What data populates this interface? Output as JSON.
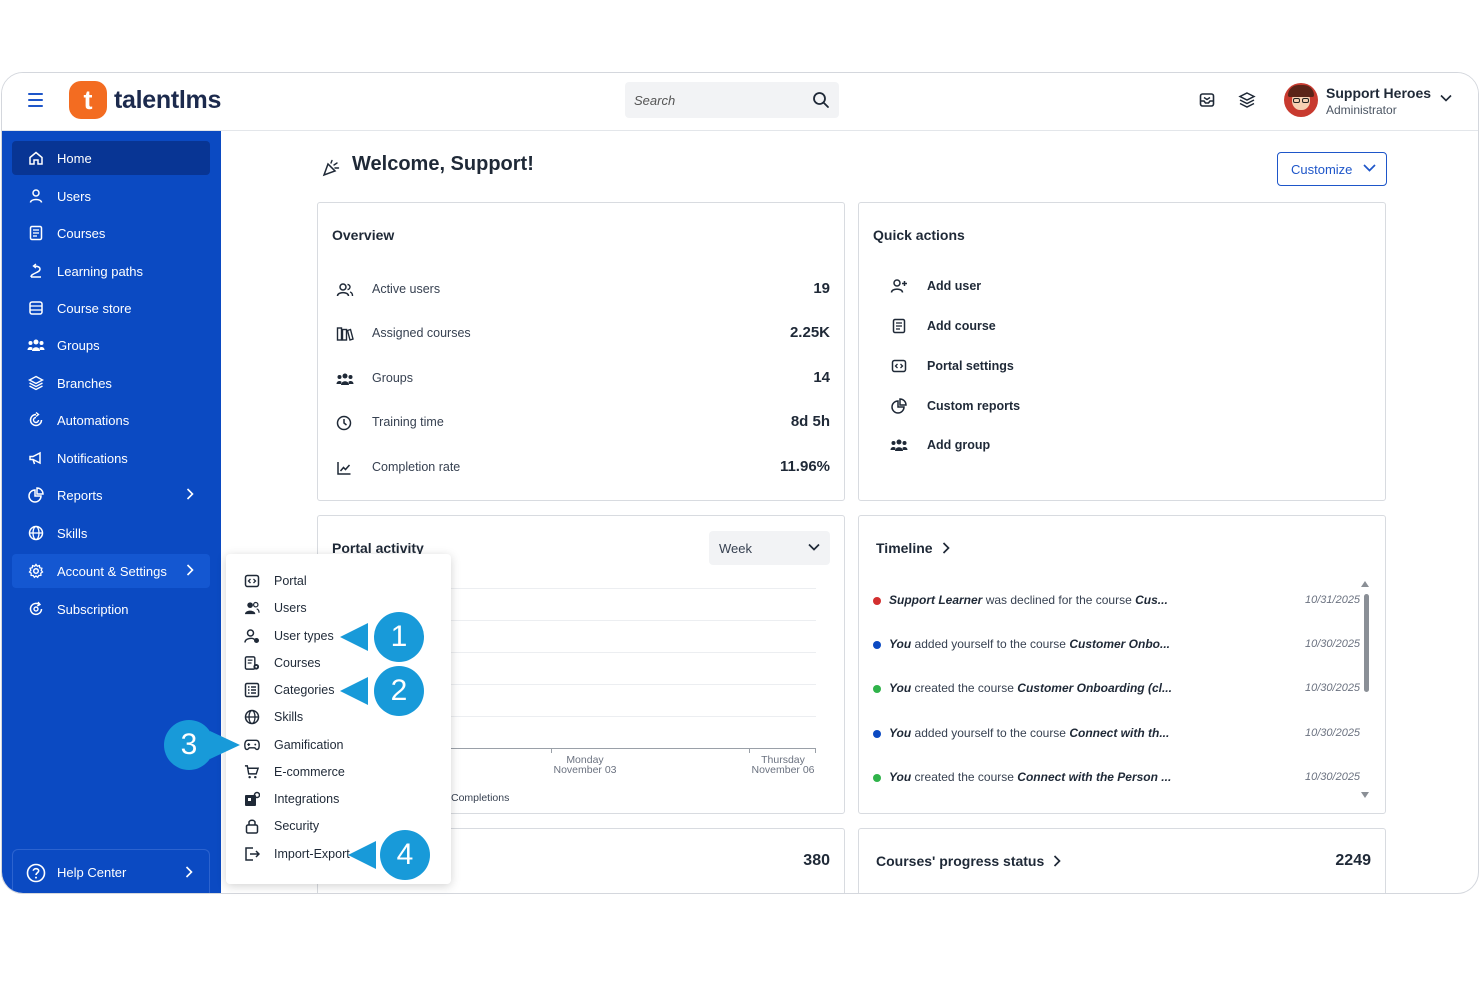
{
  "app": {
    "logo_letter": "t",
    "logo_text": "talentlms",
    "search_placeholder": "Search",
    "user_name": "Support Heroes",
    "user_role": "Administrator"
  },
  "colors": {
    "sidebar": "#0b4ac2",
    "sidebar_active": "#083594",
    "brand_orange": "#f36c21",
    "accent_blue": "#1e56c9",
    "callout": "#189ad9"
  },
  "sidebar": {
    "items": [
      {
        "label": "Home",
        "icon": "home-icon"
      },
      {
        "label": "Users",
        "icon": "user-icon"
      },
      {
        "label": "Courses",
        "icon": "course-icon"
      },
      {
        "label": "Learning paths",
        "icon": "path-icon"
      },
      {
        "label": "Course store",
        "icon": "store-icon"
      },
      {
        "label": "Groups",
        "icon": "groups-icon"
      },
      {
        "label": "Branches",
        "icon": "layers-icon"
      },
      {
        "label": "Automations",
        "icon": "automation-icon"
      },
      {
        "label": "Notifications",
        "icon": "megaphone-icon"
      },
      {
        "label": "Reports",
        "icon": "pie-chart-icon"
      },
      {
        "label": "Skills",
        "icon": "globe-icon"
      },
      {
        "label": "Account & Settings",
        "icon": "gear-icon"
      },
      {
        "label": "Subscription",
        "icon": "subscription-icon"
      }
    ],
    "help": "Help Center"
  },
  "main": {
    "welcome": "Welcome, Support!",
    "customize": "Customize"
  },
  "overview": {
    "title": "Overview",
    "rows": [
      {
        "label": "Active users",
        "value": "19"
      },
      {
        "label": "Assigned courses",
        "value": "2.25K"
      },
      {
        "label": "Groups",
        "value": "14"
      },
      {
        "label": "Training time",
        "value": "8d 5h"
      },
      {
        "label": "Completion rate",
        "value": "11.96%"
      }
    ]
  },
  "quick_actions": {
    "title": "Quick actions",
    "items": [
      "Add user",
      "Add course",
      "Portal settings",
      "Custom reports",
      "Add group"
    ]
  },
  "portal_activity": {
    "title": "Portal activity",
    "period": "Week",
    "x_labels": [
      {
        "day": "Monday",
        "date": "November 03"
      },
      {
        "day": "Thursday",
        "date": "November 06"
      }
    ],
    "legend": "Completions"
  },
  "timeline": {
    "title": "Timeline",
    "rows": [
      {
        "actor": "Support Learner",
        "text": " was declined for the course ",
        "target": "Cus...",
        "date": "10/31/2025",
        "color": "#d32f2f"
      },
      {
        "actor": "You",
        "text": " added yourself to the course ",
        "target": "Customer Onbo...",
        "date": "10/30/2025",
        "color": "#0b4ac2"
      },
      {
        "actor": "You",
        "text": " created the course ",
        "target": "Customer Onboarding (cl...",
        "date": "10/30/2025",
        "color": "#2fb34a"
      },
      {
        "actor": "You",
        "text": " added yourself to the course ",
        "target": "Connect with th...",
        "date": "10/30/2025",
        "color": "#0b4ac2"
      },
      {
        "actor": "You",
        "text": " created the course ",
        "target": "Connect with the Person ...",
        "date": "10/30/2025",
        "color": "#2fb34a"
      }
    ]
  },
  "bottom_cards": {
    "left_value": "380",
    "right_title": "Courses' progress status",
    "right_value": "2249"
  },
  "settings_menu": {
    "items": [
      "Portal",
      "Users",
      "User types",
      "Courses",
      "Categories",
      "Skills",
      "Gamification",
      "E-commerce",
      "Integrations",
      "Security",
      "Import-Export"
    ]
  },
  "callouts": [
    "1",
    "2",
    "3",
    "4"
  ]
}
